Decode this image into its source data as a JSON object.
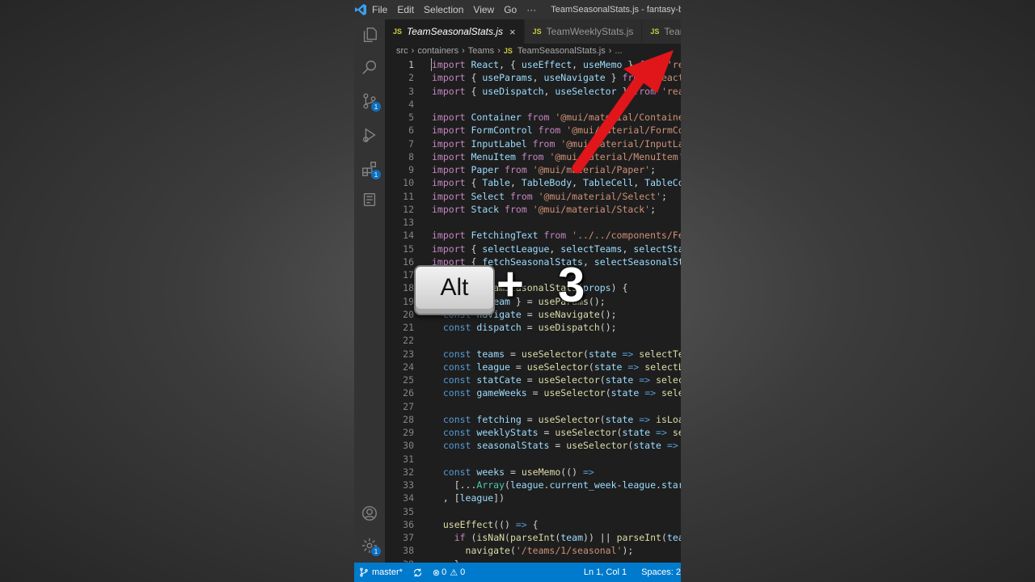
{
  "titlebar": {
    "menus": [
      "File",
      "Edit",
      "Selection",
      "View",
      "Go",
      "···"
    ],
    "window_title": "TeamSeasonalStats.js - fantasy-b"
  },
  "activity_bar": {
    "icons": [
      "explorer-icon",
      "search-icon",
      "source-control-icon",
      "run-debug-icon",
      "extensions-icon",
      "notebook-icon",
      "account-icon",
      "manage-gear-icon"
    ],
    "source_control_badge": "1",
    "extensions_badge": "1",
    "manage_badge": "1"
  },
  "tabs": [
    {
      "icon": "JS",
      "label": "TeamSeasonalStats.js",
      "active": true,
      "close": "×"
    },
    {
      "icon": "JS",
      "label": "TeamWeeklyStats.js",
      "active": false
    },
    {
      "icon": "JS",
      "label": "TeamMa",
      "active": false
    }
  ],
  "breadcrumb": [
    "src",
    "containers",
    "Teams",
    "TeamSeasonalStats.js",
    "..."
  ],
  "breadcrumb_icon": "JS",
  "editor": {
    "current_line": 1,
    "lines": [
      {
        "n": "1",
        "html": "<span class='kw'>import</span> <span class='id'>React</span>, { <span class='id'>useEffect</span>, <span class='id'>useMemo</span> } <span class='kw'>from</span> <span class='str'>'reac</span>"
      },
      {
        "n": "2",
        "html": "<span class='kw'>import</span> { <span class='id'>useParams</span>, <span class='id'>useNavigate</span> } <span class='kw'>from</span> <span class='str'>'react-r</span>"
      },
      {
        "n": "3",
        "html": "<span class='kw'>import</span> { <span class='id'>useDispatch</span>, <span class='id'>useSelector</span> } <span class='kw'>from</span> <span class='str'>'react</span>"
      },
      {
        "n": "4",
        "html": ""
      },
      {
        "n": "5",
        "html": "<span class='kw'>import</span> <span class='id'>Container</span> <span class='kw'>from</span> <span class='str'>'@mui/material/Container'</span>"
      },
      {
        "n": "6",
        "html": "<span class='kw'>import</span> <span class='id'>FormControl</span> <span class='kw'>from</span> <span class='str'>'@mui/material/FormCont</span>"
      },
      {
        "n": "7",
        "html": "<span class='kw'>import</span> <span class='id'>InputLabel</span> <span class='kw'>from</span> <span class='str'>'@mui/material/InputLabe</span>"
      },
      {
        "n": "8",
        "html": "<span class='kw'>import</span> <span class='id'>MenuItem</span> <span class='kw'>from</span> <span class='str'>'@mui/material/MenuItem'</span>;"
      },
      {
        "n": "9",
        "html": "<span class='kw'>import</span> <span class='id'>Paper</span> <span class='kw'>from</span> <span class='str'>'@mui/material/Paper'</span>;"
      },
      {
        "n": "10",
        "html": "<span class='kw'>import</span> { <span class='id'>Table</span>, <span class='id'>TableBody</span>, <span class='id'>TableCell</span>, <span class='id'>TableCont</span>"
      },
      {
        "n": "11",
        "html": "<span class='kw'>import</span> <span class='id'>Select</span> <span class='kw'>from</span> <span class='str'>'@mui/material/Select'</span>;"
      },
      {
        "n": "12",
        "html": "<span class='kw'>import</span> <span class='id'>Stack</span> <span class='kw'>from</span> <span class='str'>'@mui/material/Stack'</span>;"
      },
      {
        "n": "13",
        "html": ""
      },
      {
        "n": "14",
        "html": "<span class='kw'>import</span> <span class='id'>FetchingText</span> <span class='kw'>from</span> <span class='str'>'../../components/Fetc</span>"
      },
      {
        "n": "15",
        "html": "<span class='kw'>import</span> { <span class='id'>selectLeague</span>, <span class='id'>selectTeams</span>, <span class='id'>selectStatC</span>"
      },
      {
        "n": "16",
        "html": "<span class='kw'>import</span> { <span class='id'>fetchSeasonalStats</span>, <span class='id'>selectSeasonalStat</span>"
      },
      {
        "n": "17",
        "html": ""
      },
      {
        "n": "18",
        "html": "<span class='k2'>function</span> <span class='fn'>TeamSeasonalStats</span>(<span class='id'>props</span>) {"
      },
      {
        "n": "19",
        "html": "  <span class='k2'>const</span> { <span class='id'>team</span> } = <span class='fn'>useParams</span>();"
      },
      {
        "n": "20",
        "html": "  <span class='k2'>const</span> <span class='id'>navigate</span> = <span class='fn'>useNavigate</span>();"
      },
      {
        "n": "21",
        "html": "  <span class='k2'>const</span> <span class='id'>dispatch</span> = <span class='fn'>useDispatch</span>();"
      },
      {
        "n": "22",
        "html": ""
      },
      {
        "n": "23",
        "html": "  <span class='k2'>const</span> <span class='id'>teams</span> = <span class='fn'>useSelector</span>(<span class='id'>state</span> <span class='k2'>=></span> <span class='fn'>selectTeam</span>"
      },
      {
        "n": "24",
        "html": "  <span class='k2'>const</span> <span class='id'>league</span> = <span class='fn'>useSelector</span>(<span class='id'>state</span> <span class='k2'>=></span> <span class='fn'>selectLea</span>"
      },
      {
        "n": "25",
        "html": "  <span class='k2'>const</span> <span class='id'>statCate</span> = <span class='fn'>useSelector</span>(<span class='id'>state</span> <span class='k2'>=></span> <span class='fn'>selectS</span>"
      },
      {
        "n": "26",
        "html": "  <span class='k2'>const</span> <span class='id'>gameWeeks</span> = <span class='fn'>useSelector</span>(<span class='id'>state</span> <span class='k2'>=></span> <span class='fn'>select</span>"
      },
      {
        "n": "27",
        "html": ""
      },
      {
        "n": "28",
        "html": "  <span class='k2'>const</span> <span class='id'>fetching</span> = <span class='fn'>useSelector</span>(<span class='id'>state</span> <span class='k2'>=></span> <span class='fn'>isLoadi</span>"
      },
      {
        "n": "29",
        "html": "  <span class='k2'>const</span> <span class='id'>weeklyStats</span> = <span class='fn'>useSelector</span>(<span class='id'>state</span> <span class='k2'>=></span> <span class='fn'>sele</span>"
      },
      {
        "n": "30",
        "html": "  <span class='k2'>const</span> <span class='id'>seasonalStats</span> = <span class='fn'>useSelector</span>(<span class='id'>state</span> <span class='k2'>=></span> <span class='fn'>se</span>"
      },
      {
        "n": "31",
        "html": ""
      },
      {
        "n": "32",
        "html": "  <span class='k2'>const</span> <span class='id'>weeks</span> = <span class='fn'>useMemo</span>(() <span class='k2'>=></span>"
      },
      {
        "n": "33",
        "html": "    [...<span class='cls'>Array</span>(<span class='id'>league</span>.<span class='id'>current_week</span>-<span class='id'>league</span>.<span class='id'>start_</span>"
      },
      {
        "n": "34",
        "html": "  , [<span class='id'>league</span>])"
      },
      {
        "n": "35",
        "html": ""
      },
      {
        "n": "36",
        "html": "  <span class='fn'>useEffect</span>(() <span class='k2'>=></span> {"
      },
      {
        "n": "37",
        "html": "    <span class='kw'>if</span> (<span class='fn'>isNaN</span>(<span class='fn'>parseInt</span>(<span class='id'>team</span>)) || <span class='fn'>parseInt</span>(<span class='id'>team</span>)"
      },
      {
        "n": "38",
        "html": "      <span class='fn'>navigate</span>(<span class='str'>'/teams/1/seasonal'</span>);"
      },
      {
        "n": "39",
        "html": "    }"
      }
    ]
  },
  "statusbar": {
    "branch": "master*",
    "errors": "0",
    "warnings": "0",
    "position": "Ln 1, Col 1",
    "spaces": "Spaces: 2"
  },
  "overlay": {
    "key_label": "Alt",
    "plus": "+",
    "number": "3"
  },
  "colors": {
    "accent": "#007acc",
    "arrow": "#e0161b",
    "editor_bg": "#1e1e1e"
  }
}
